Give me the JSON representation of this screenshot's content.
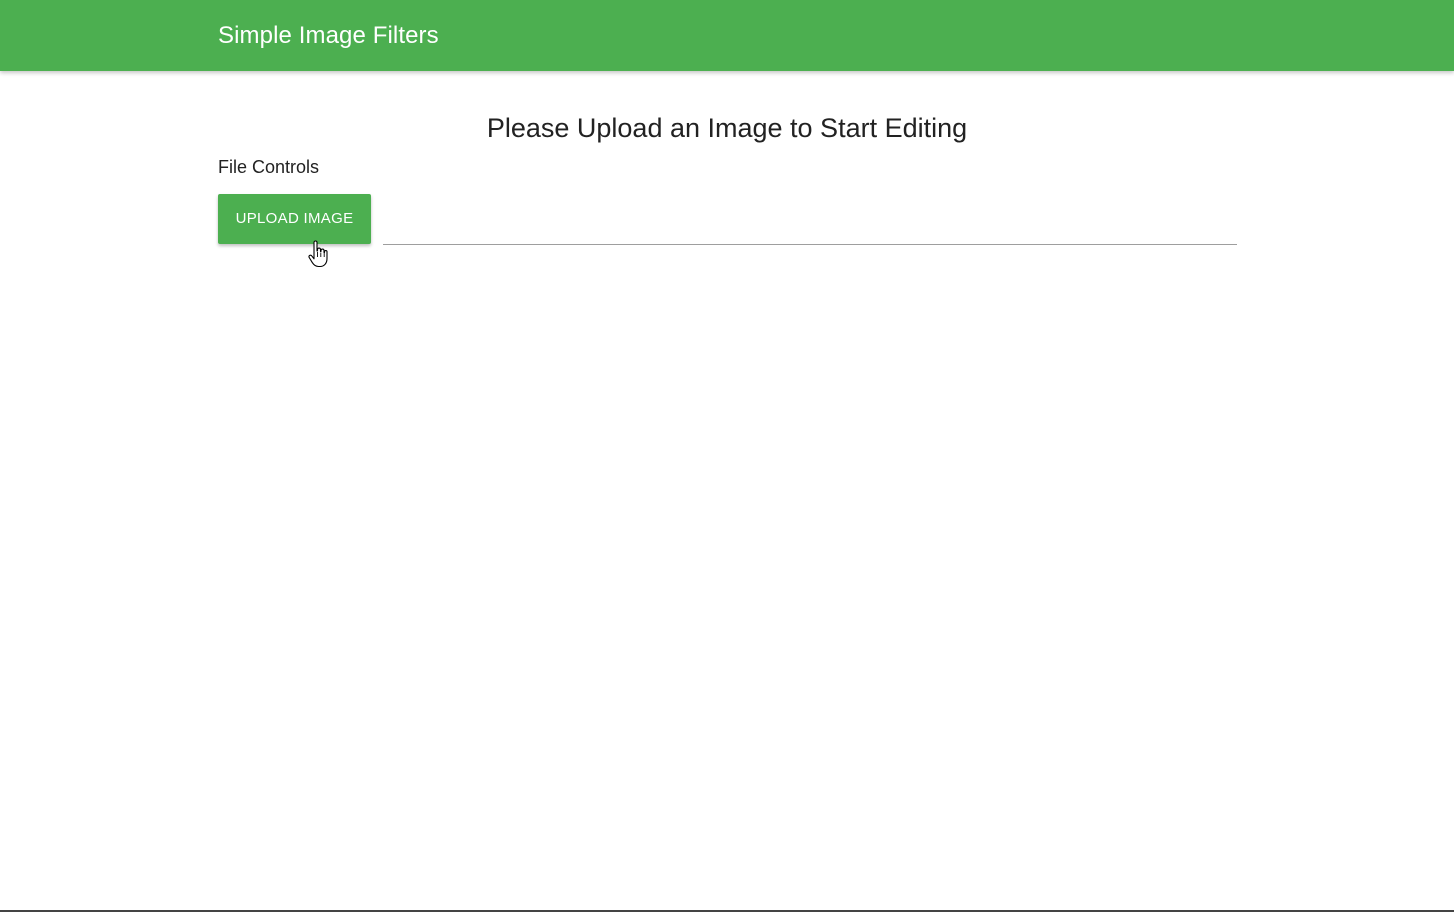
{
  "app": {
    "title": "Simple Image Filters"
  },
  "main": {
    "heading": "Please Upload an Image to Start Editing",
    "file_controls": {
      "label": "File Controls",
      "upload_button_label": "UPLOAD IMAGE",
      "file_path_value": ""
    }
  },
  "icons": {
    "cursor": "hand-pointer-icon"
  },
  "colors": {
    "accent": "#4caf50",
    "text": "#222222",
    "underline": "#9e9e9e"
  }
}
